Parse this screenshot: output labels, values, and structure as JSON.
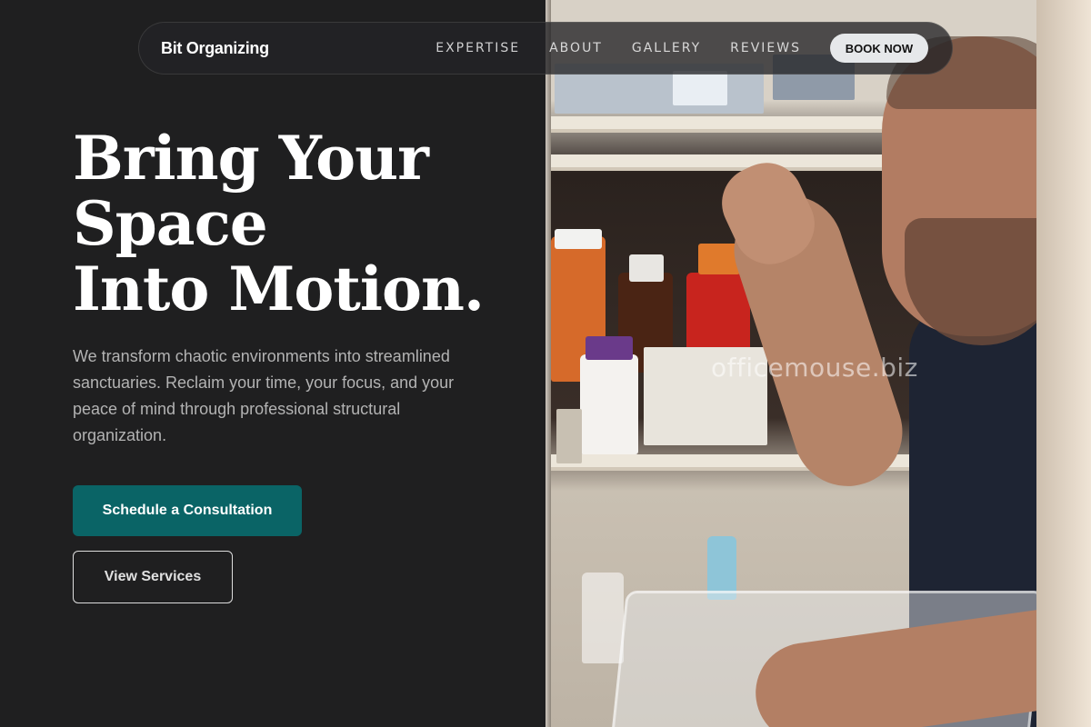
{
  "nav": {
    "brand": "Bit Organizing",
    "links": [
      "EXPERTISE",
      "ABOUT",
      "GALLERY",
      "REVIEWS"
    ],
    "cta": "BOOK NOW"
  },
  "hero": {
    "title_lines": [
      "Bring Your",
      "Space",
      "Into Motion."
    ],
    "description": "We transform chaotic environments into streamlined sanctuaries. Reclaim your time, your focus, and your peace of mind through professional structural organization.",
    "primary_button": "Schedule a Consultation",
    "secondary_button": "View Services"
  },
  "photo": {
    "watermark": "officemouse.biz"
  },
  "colors": {
    "background": "#1f1f20",
    "accent": "#0a6466",
    "nav_cta_bg": "#e6e8ea"
  }
}
